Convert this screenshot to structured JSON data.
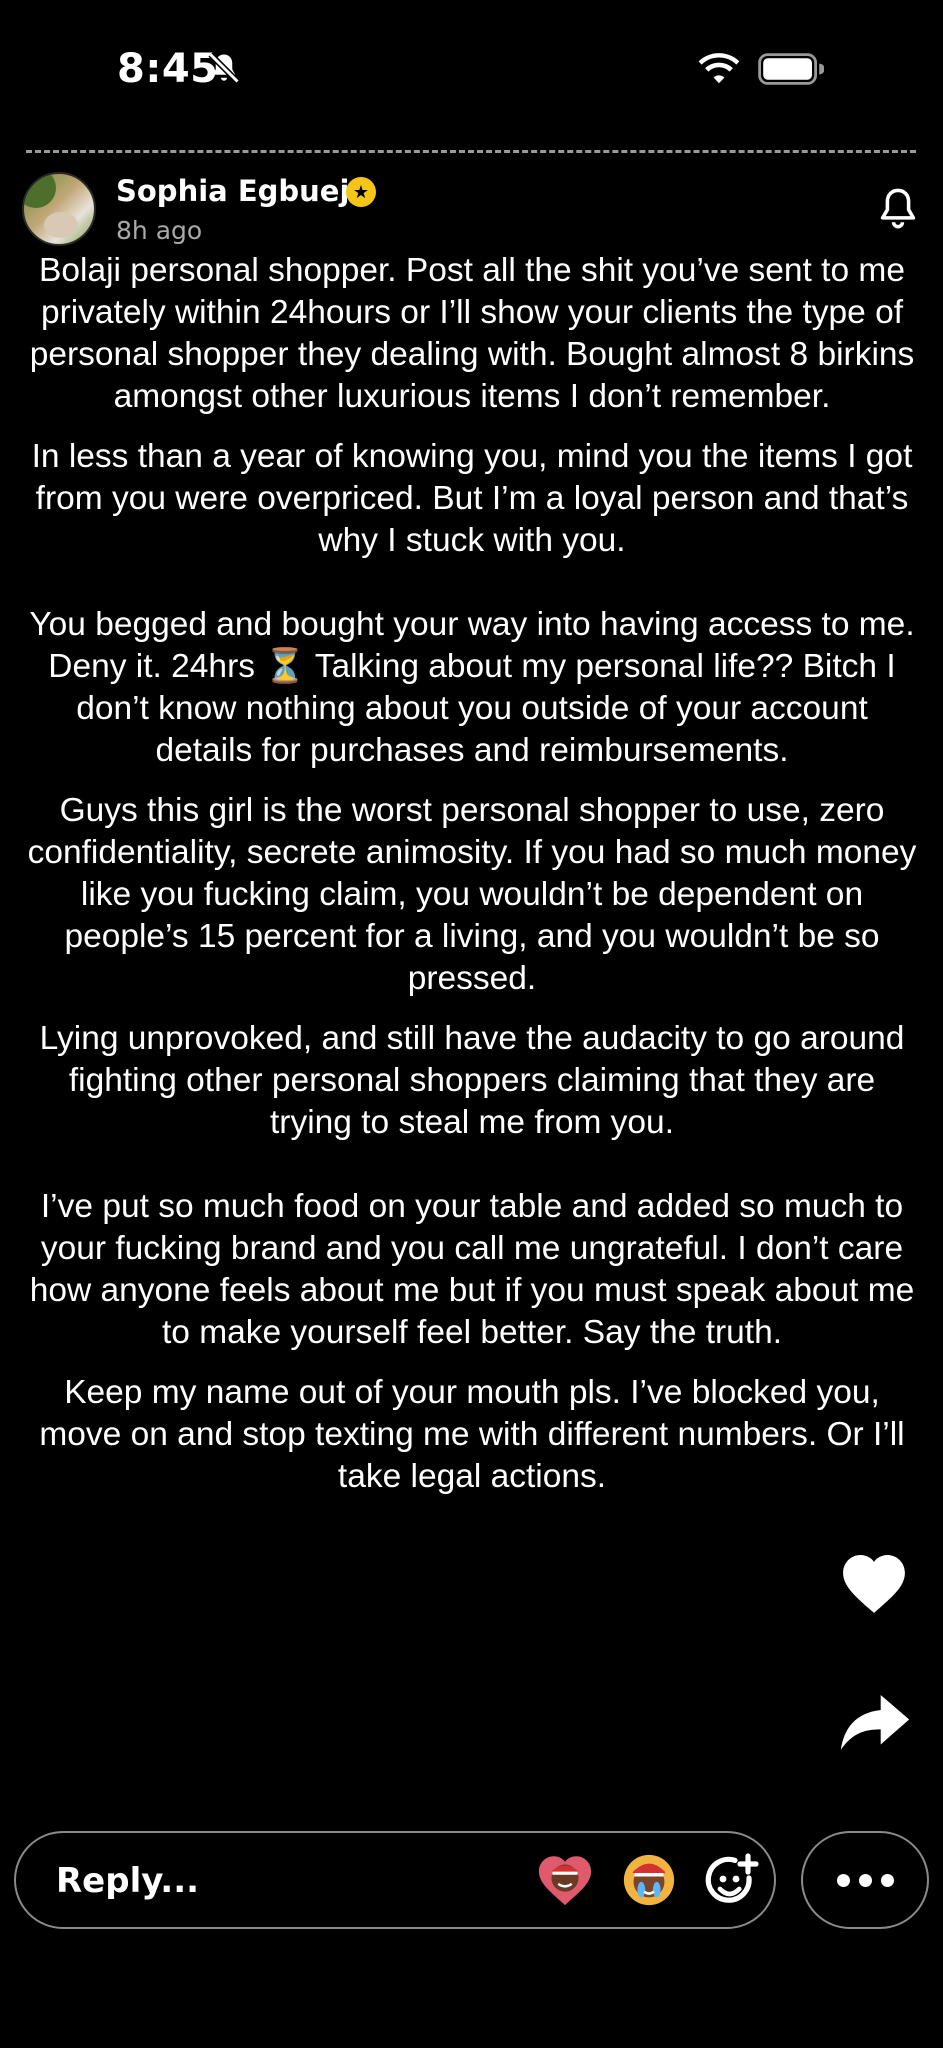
{
  "status_bar": {
    "time": "8:45",
    "icons": [
      "bell-slash-icon",
      "wifi-icon",
      "battery-icon"
    ]
  },
  "story": {
    "author": {
      "name": "Sophia Egbueje",
      "verified_icon": "star-badge-icon",
      "posted": "8h ago"
    },
    "subscribe_icon": "bell-icon",
    "paragraphs": [
      "Bolaji personal shopper. Post all the shit you’ve sent to me privately within 24hours or I’ll show your clients the type of personal shopper they dealing with. Bought almost 8 birkins amongst other luxurious items I don’t remember.",
      "In less than a year of knowing you, mind you the items I got from you were overpriced. But I’m a loyal person and that’s why I stuck with you.",
      "You begged and bought your way into having access to me. Deny it.  24hrs ⏳ Talking about my personal life?? Bitch I don’t know nothing about you outside of your account details for purchases and reimbursements.",
      "Guys this girl is the worst personal shopper to use, zero confidentiality, secrete animosity. If you had so much money like you fucking claim, you wouldn’t be dependent on people’s 15 percent for a living, and you wouldn’t be so pressed.",
      "Lying unprovoked, and still have the audacity to go around fighting other personal shoppers claiming that they are trying to steal me from you.",
      "I’ve put so much food on your table and added so much to your fucking brand and you call me ungrateful. I don’t care how anyone feels about me but if you must speak about me to make yourself feel better. Say the truth.",
      "Keep my name out of your mouth pls. I’ve blocked you, move on and stop texting me with different numbers. Or I’ll take legal actions."
    ]
  },
  "actions": {
    "like_icon": "heart-icon",
    "share_icon": "share-arrow-icon"
  },
  "reply": {
    "placeholder": "Reply...",
    "reaction_icons": [
      "bitmoji-heart-icon",
      "bitmoji-crying-icon",
      "add-reaction-icon"
    ],
    "more_icon": "more-dots-icon"
  },
  "colors": {
    "background": "#000000",
    "text": "#ffffff",
    "muted": "#a9a9a9",
    "verified": "#f5c518"
  }
}
